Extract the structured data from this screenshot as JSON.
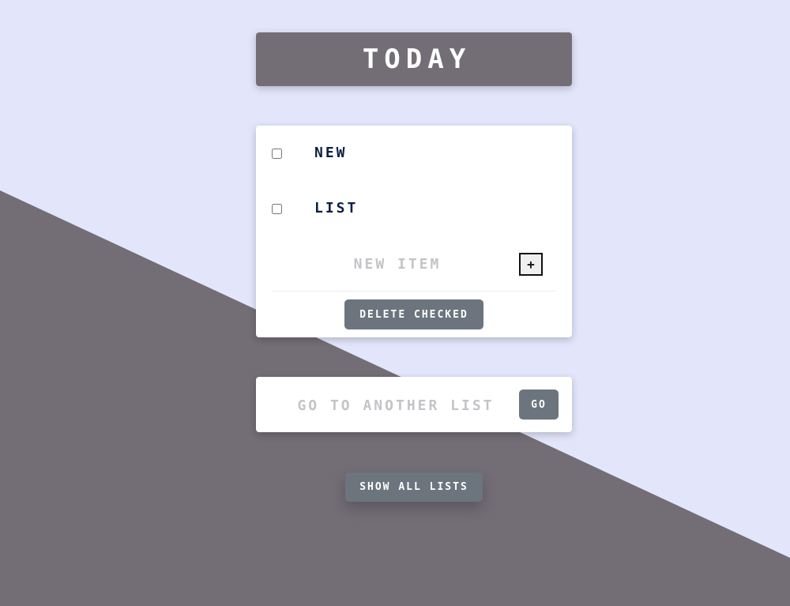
{
  "colors": {
    "page_background": "#e3e6fb",
    "diagonal_background": "#736e76",
    "title_bar": "#736e76",
    "button": "#6c757d",
    "item_text": "#0d1f44",
    "placeholder_text": "#c4c4c8"
  },
  "header": {
    "title": "TODAY"
  },
  "list": {
    "items": [
      {
        "label": "NEW",
        "checked": false
      },
      {
        "label": "LIST",
        "checked": false
      }
    ],
    "new_item_placeholder": "NEW ITEM",
    "add_button_label": "+",
    "delete_checked_label": "DELETE CHECKED"
  },
  "goto": {
    "placeholder": "GO TO ANOTHER LIST",
    "button_label": "GO"
  },
  "footer": {
    "show_all_label": "SHOW ALL LISTS"
  }
}
